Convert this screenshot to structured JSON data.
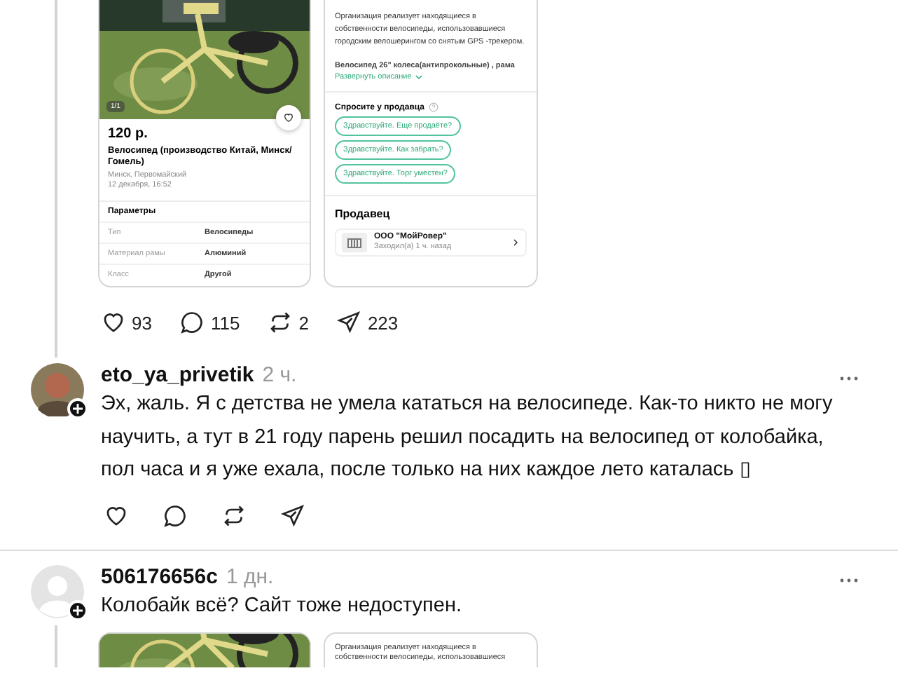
{
  "post": {
    "listing_screenshot": {
      "photo_counter": "1/1",
      "price": "120 р.",
      "title": "Велосипед (производство Китай, Минск/ Гомель)",
      "location": "Минск, Первомайский",
      "date": "12 декабря, 16:52",
      "params_title": "Параметры",
      "params": [
        {
          "name": "Тип",
          "value": "Велосипеды"
        },
        {
          "name": "Материал рамы",
          "value": "Алюминий"
        },
        {
          "name": "Класс",
          "value": "Другой"
        }
      ]
    },
    "description_screenshot": {
      "description": "Организация реализует находящиеся в собственности велосипеды, использовавшиеся городским велошерингом со снятым GPS -трекером.",
      "details": "Велосипед 26\" колеса(антипрокольные) , рама",
      "expand_link": "Развернуть описание",
      "ask_title": "Спросите у продавца",
      "quick_questions": [
        "Здравствуйте. Еще продаёте?",
        "Здравствуйте. Как забрать?",
        "Здравствуйте. Торг уместен?"
      ],
      "seller_title": "Продавец",
      "seller_name": "ООО \"МойРовер\"",
      "seller_status": "Заходил(а) 1 ч. назад"
    },
    "actions": [
      {
        "kind": "like",
        "count": "93"
      },
      {
        "kind": "reply",
        "count": "115"
      },
      {
        "kind": "repost",
        "count": "2"
      },
      {
        "kind": "share",
        "count": "223"
      }
    ]
  },
  "comments": [
    {
      "username": "eto_ya_privetik",
      "time": "2 ч.",
      "text": "Эх, жаль. Я с детства не умела кататься на велосипеде. Как-то никто не могу научить, а тут в 21 году парень решил посадить на велосипед от колобайка, пол часа и я уже ехала, после только на них каждое лето каталась ▯",
      "actions": [
        {
          "kind": "like"
        },
        {
          "kind": "reply"
        },
        {
          "kind": "repost"
        },
        {
          "kind": "share"
        }
      ]
    },
    {
      "avatar": {
        "kind": "default"
      },
      "username": "506176656c",
      "time": "1 дн.",
      "text": "Колобайк всё? Сайт тоже недоступен.",
      "attachment": {
        "description_lines": [
          "Организация реализует находящиеся в",
          "собственности велосипеды, использовавшиеся"
        ]
      }
    }
  ]
}
